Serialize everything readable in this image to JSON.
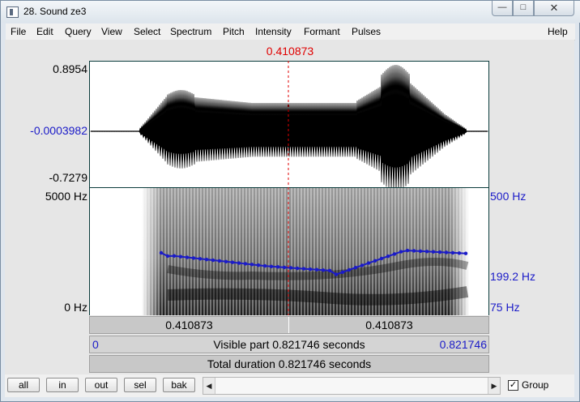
{
  "window": {
    "title": "28. Sound ze3",
    "minimize_glyph": "—",
    "maximize_glyph": "□",
    "close_glyph": "✕"
  },
  "menu": [
    {
      "label": "File"
    },
    {
      "label": "Edit"
    },
    {
      "label": "Query"
    },
    {
      "label": "View"
    },
    {
      "label": "Select"
    },
    {
      "label": "Spectrum"
    },
    {
      "label": "Pitch"
    },
    {
      "label": "Intensity"
    },
    {
      "label": "Formant"
    },
    {
      "label": "Pulses"
    },
    {
      "label": "Help"
    }
  ],
  "cursor": {
    "time": "0.410873",
    "color": "#e00000"
  },
  "waveform": {
    "max_label": "0.8954",
    "cursor_value_label": "-0.0003982",
    "min_label": "-0.7279"
  },
  "spectrogram": {
    "top_freq_label": "5000 Hz",
    "bottom_freq_label": "0 Hz"
  },
  "pitch": {
    "top_label": "500 Hz",
    "cursor_label": "199.2 Hz",
    "bottom_label": "75 Hz",
    "color": "#1b1bc8"
  },
  "rulers": {
    "left_segment": "0.410873",
    "right_segment": "0.410873",
    "visible_start": "0",
    "visible_part": "Visible part 0.821746 seconds",
    "visible_end": "0.821746",
    "total_duration": "Total duration 0.821746 seconds"
  },
  "buttons": [
    {
      "label": "all"
    },
    {
      "label": "in"
    },
    {
      "label": "out"
    },
    {
      "label": "sel"
    },
    {
      "label": "bak"
    }
  ],
  "scrollbar": {
    "left_arrow": "◀",
    "right_arrow": "▶"
  },
  "group": {
    "label": "Group",
    "checked": true,
    "check_glyph": "✓"
  },
  "icons": [
    "app-icon",
    "minimize-icon",
    "maximize-icon",
    "close-icon",
    "scroll-left-icon",
    "scroll-right-icon"
  ]
}
